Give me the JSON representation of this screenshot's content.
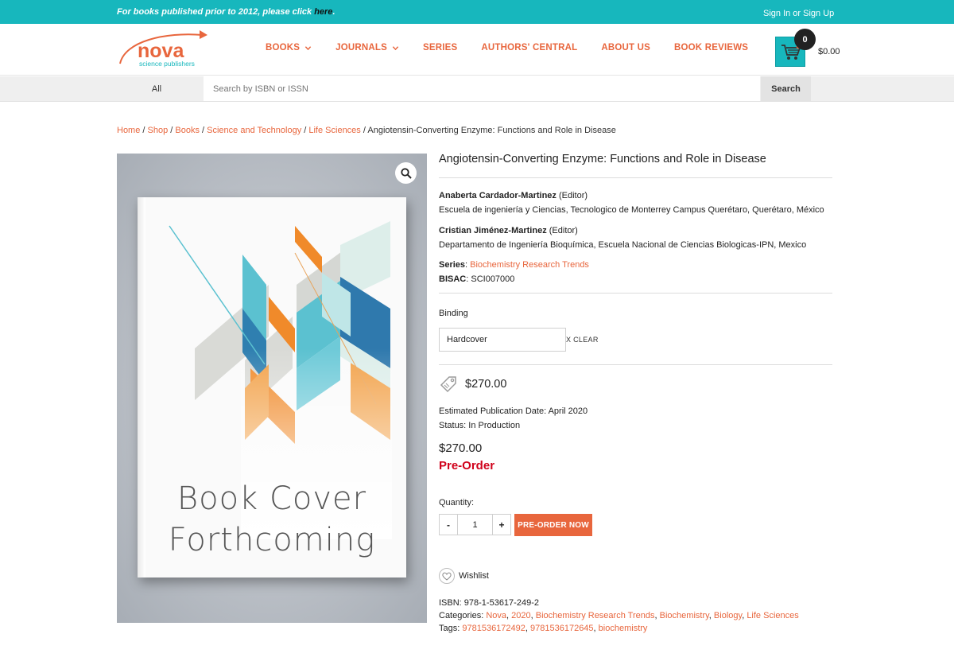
{
  "topbar": {
    "notice_text": "For books published prior to 2012, please click ",
    "notice_link": "here",
    "notice_end": ".",
    "signin": "Sign In or Sign Up"
  },
  "logo": {
    "name": "nova",
    "tagline": "science publishers"
  },
  "nav": {
    "items": [
      {
        "label": "BOOKS",
        "has_dropdown": true
      },
      {
        "label": "JOURNALS",
        "has_dropdown": true
      },
      {
        "label": "SERIES",
        "has_dropdown": false
      },
      {
        "label": "AUTHORS' CENTRAL",
        "has_dropdown": false
      },
      {
        "label": "ABOUT US",
        "has_dropdown": false
      },
      {
        "label": "BOOK REVIEWS",
        "has_dropdown": false
      }
    ]
  },
  "cart": {
    "count": "0",
    "total": "$0.00"
  },
  "search": {
    "category": "All",
    "placeholder": "Search by ISBN or ISSN",
    "button": "Search"
  },
  "breadcrumb": {
    "items": [
      "Home",
      "Shop",
      "Books",
      "Science and Technology",
      "Life Sciences"
    ],
    "separator": " / ",
    "current": "Angiotensin-Converting Enzyme: Functions and Role in Disease"
  },
  "cover": {
    "line1": "Book Cover",
    "line2": "Forthcoming"
  },
  "product": {
    "title": "Angiotensin-Converting Enzyme: Functions and Role in Disease",
    "editors": [
      {
        "name": "Anaberta Cardador-Martinez",
        "role": " (Editor)",
        "affiliation": "Escuela de ingeniería y Ciencias, Tecnologico de Monterrey Campus Querétaro, Querétaro, México"
      },
      {
        "name": "Cristian Jiménez-Martinez",
        "role": " (Editor)",
        "affiliation": "Departamento de Ingeniería Bioquímica, Escuela Nacional de Ciencias Biologicas-IPN, Mexico"
      }
    ],
    "series_label": "Series",
    "series_value": "Biochemistry Research Trends",
    "bisac_label": "BISAC",
    "bisac_value": "SCI007000",
    "binding_label": "Binding",
    "binding_value": "Hardcover",
    "clear_label": "X CLEAR",
    "price": "$270.00",
    "est_pub": "Estimated Publication Date: April 2020",
    "status": "Status: In Production",
    "price2": "$270.00",
    "availability": "Pre-Order",
    "quantity_label": "Quantity:",
    "quantity_value": "1",
    "qty_minus": "-",
    "qty_plus": "+",
    "preorder_button": "PRE-ORDER NOW",
    "wishlist": "Wishlist",
    "isbn": "ISBN: 978-1-53617-249-2",
    "categories_label": "Categories: ",
    "categories": [
      "Nova",
      "2020",
      "Biochemistry Research Trends",
      "Biochemistry",
      "Biology",
      "Life Sciences"
    ],
    "tags_label": "Tags: ",
    "tags": [
      "9781536172492",
      "9781536172645",
      "biochemistry"
    ]
  },
  "colors": {
    "teal": "#17b7bd",
    "accent": "#e8663d",
    "preorder": "#d0021b"
  }
}
